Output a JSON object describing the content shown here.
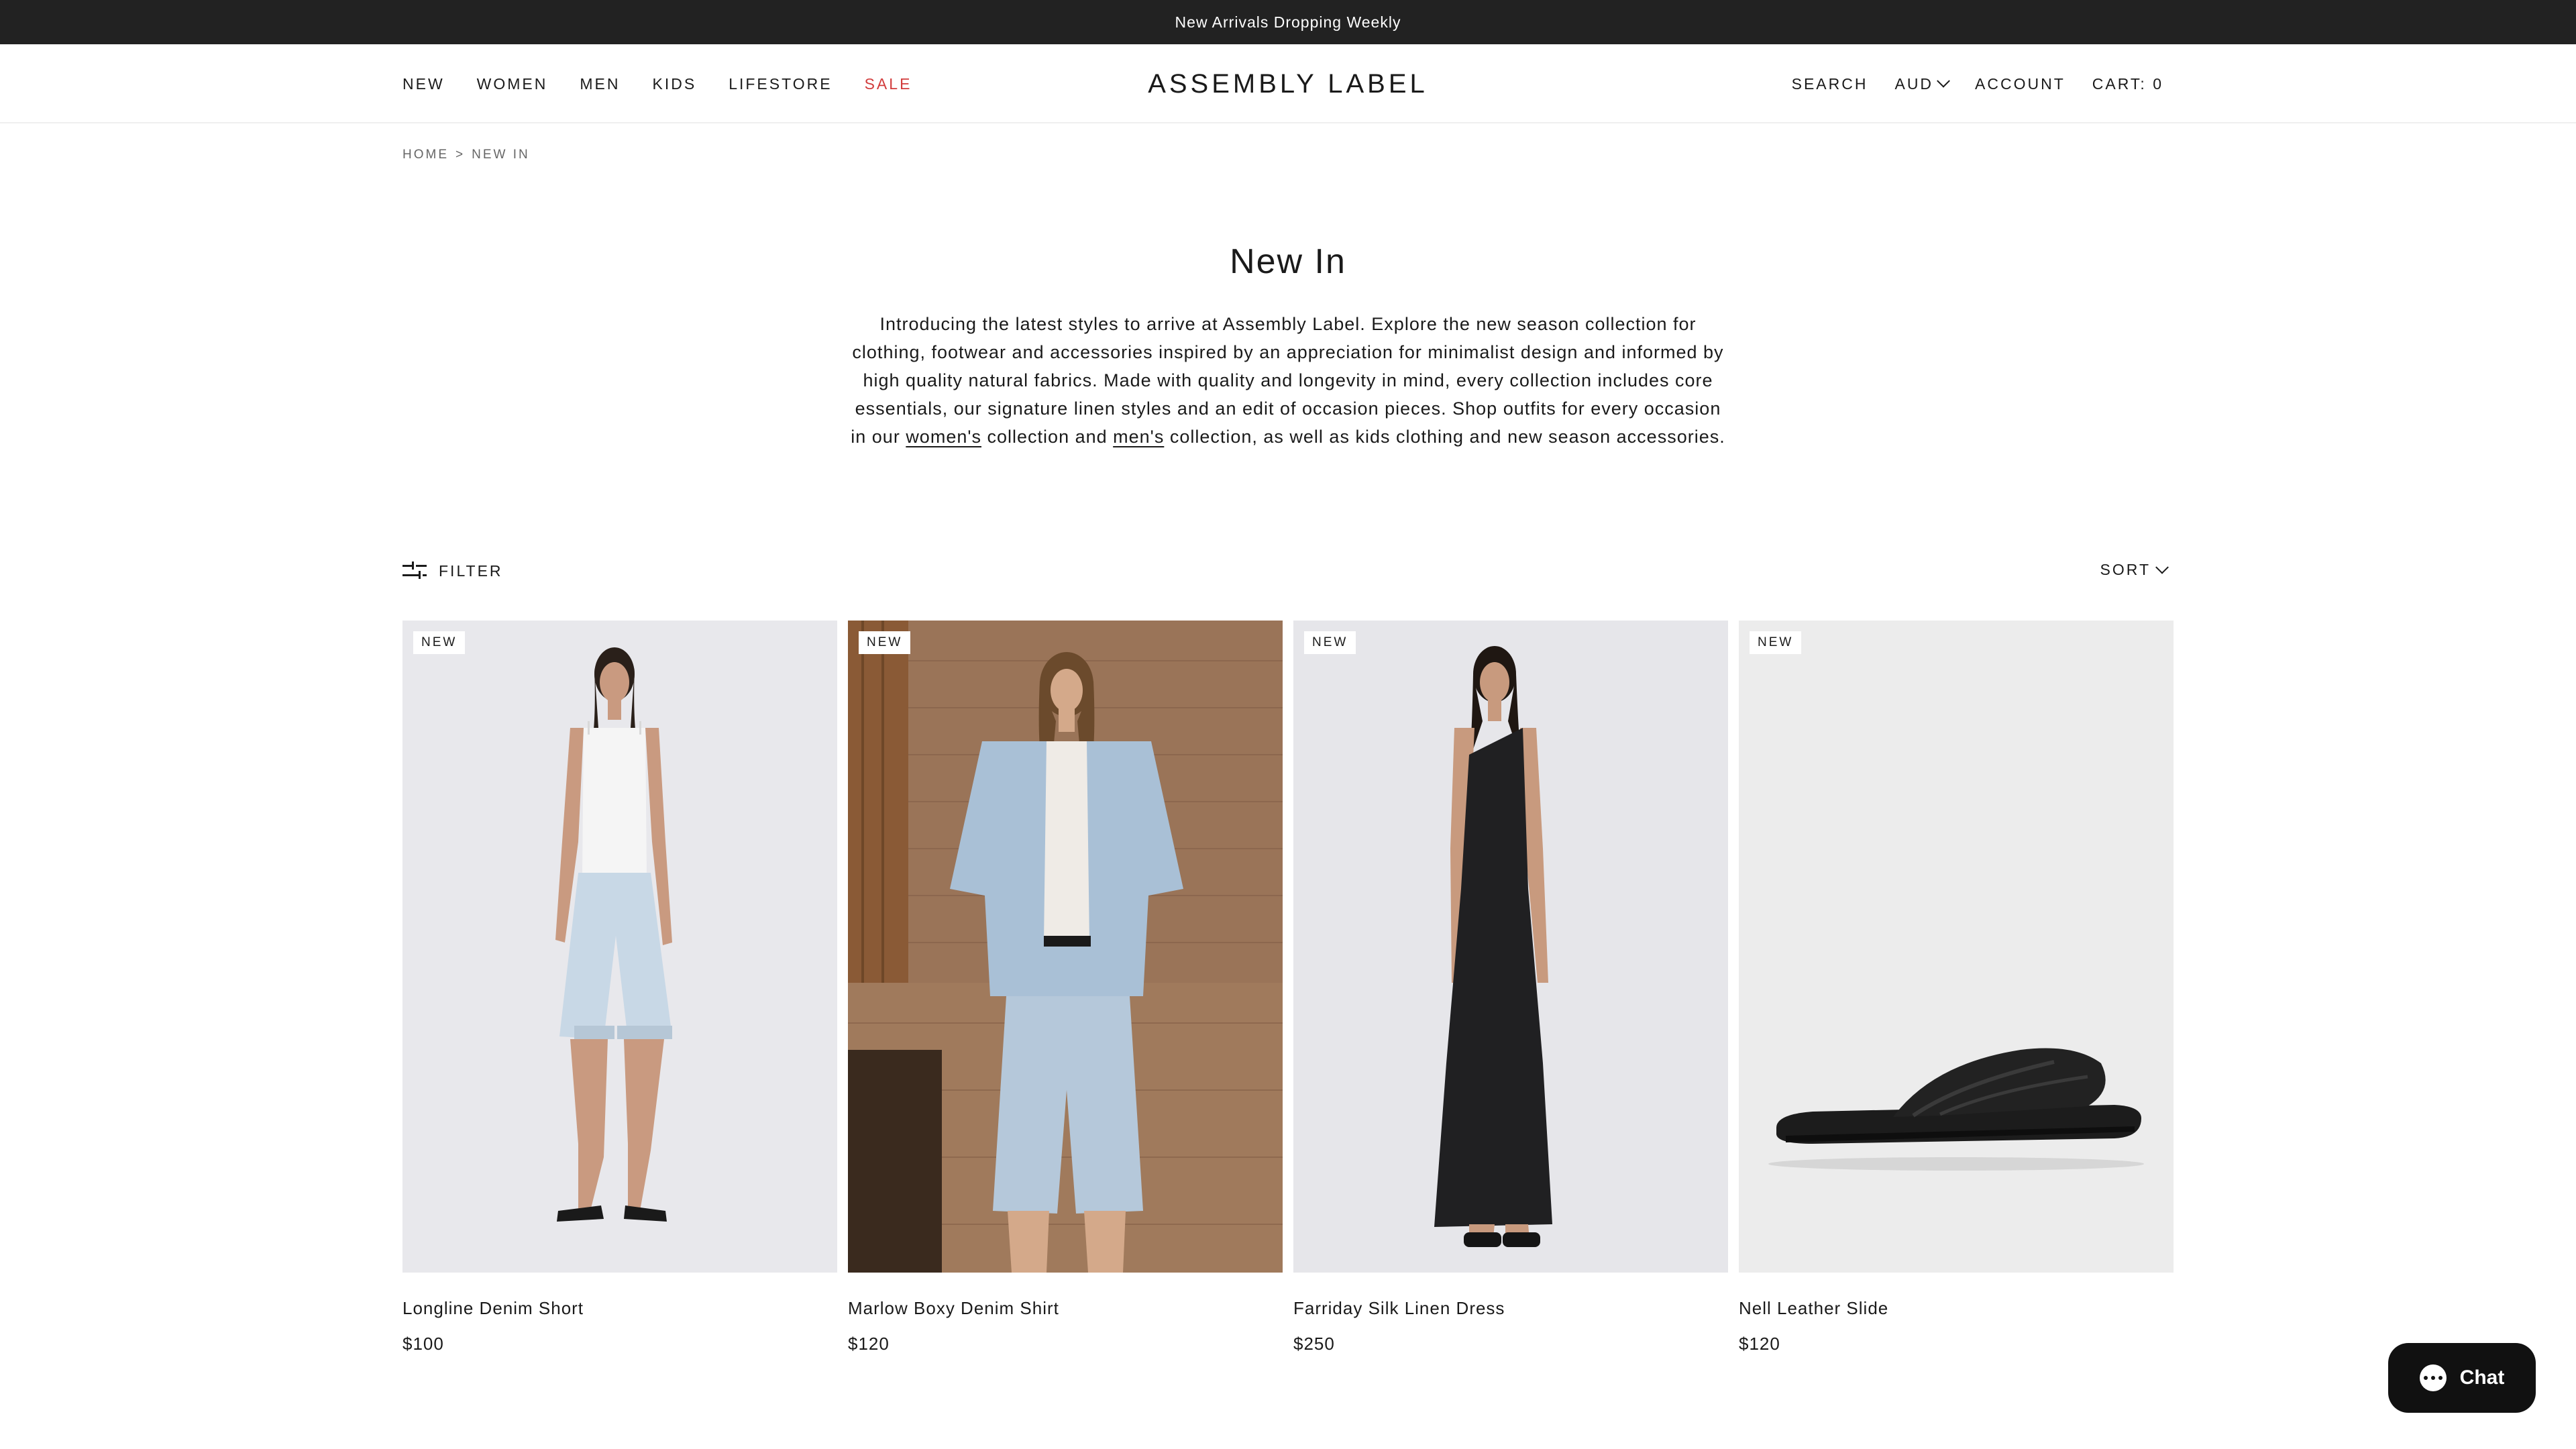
{
  "announcement": "New Arrivals Dropping Weekly",
  "nav": {
    "left": [
      "NEW",
      "WOMEN",
      "MEN",
      "KIDS",
      "LIFESTORE",
      "SALE"
    ],
    "logo": "ASSEMBLY LABEL",
    "search": "SEARCH",
    "currency": "AUD",
    "account": "ACCOUNT",
    "cart": "CART: 0"
  },
  "breadcrumb": {
    "home": "HOME",
    "sep": ">",
    "current": "NEW IN"
  },
  "page": {
    "title": "New In",
    "intro_a": "Introducing the latest styles to arrive at Assembly Label. Explore the new season collection for clothing, footwear and accessories inspired by an appreciation for minimalist design and informed by high quality natural fabrics. Made with quality and longevity in mind, every collection includes core essentials, our signature linen styles and an edit of occasion pieces. Shop outfits for every occasion in our ",
    "intro_link_women": "women's",
    "intro_b": " collection and ",
    "intro_link_men": "men's",
    "intro_c": " collection, as well as kids clothing and new season accessories."
  },
  "toolbar": {
    "filter": "FILTER",
    "sort": "SORT"
  },
  "products": [
    {
      "badge": "NEW",
      "name": "Longline Denim Short",
      "price": "$100"
    },
    {
      "badge": "NEW",
      "name": "Marlow Boxy Denim Shirt",
      "price": "$120"
    },
    {
      "badge": "NEW",
      "name": "Farriday Silk Linen Dress",
      "price": "$250"
    },
    {
      "badge": "NEW",
      "name": "Nell Leather Slide",
      "price": "$120"
    }
  ],
  "chat": {
    "label": "Chat"
  },
  "colors": {
    "sale": "#d23c3c",
    "announcement_bg": "#222222",
    "chat_bg": "#111111"
  },
  "icons": [
    "filter-icon",
    "chevron-down-icon",
    "chat-bubble-icon"
  ]
}
